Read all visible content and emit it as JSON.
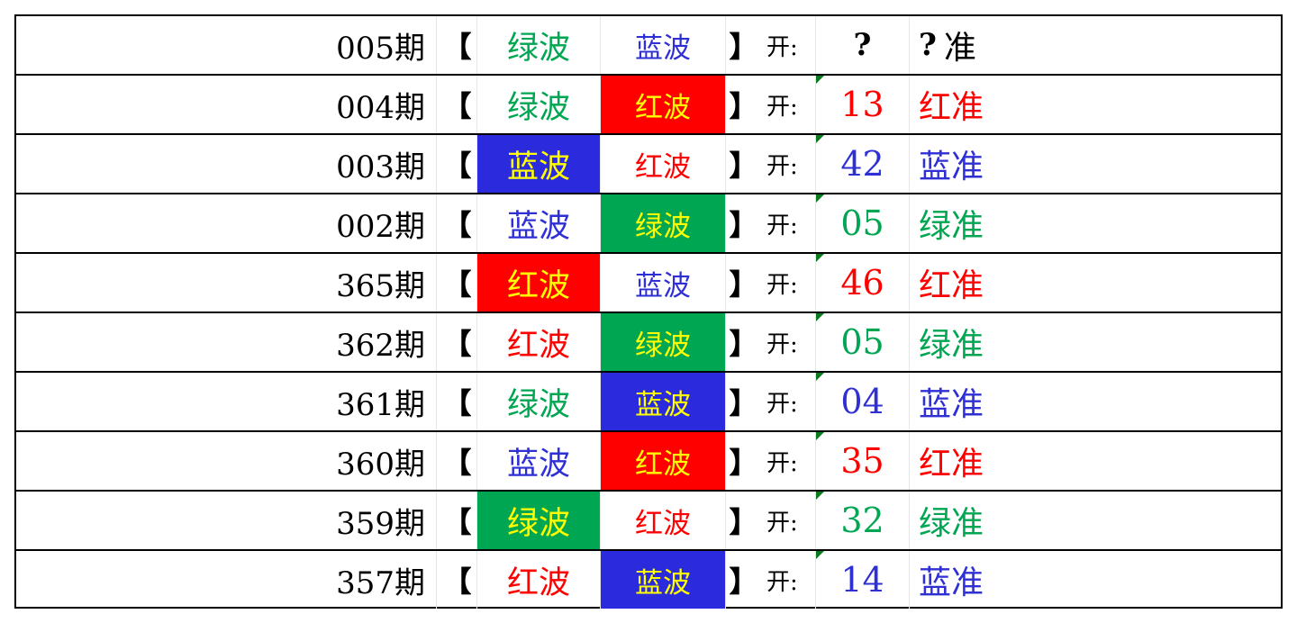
{
  "rows": [
    {
      "period": "005期",
      "left_bracket": "【",
      "c1": {
        "text": "绿波",
        "fg": "#00a651",
        "bg": ""
      },
      "c2": {
        "text": "蓝波",
        "fg": "#2f2fd6",
        "bg": ""
      },
      "right_bracket": "】",
      "kai": "开:",
      "number": {
        "text": "?",
        "color": "#000000"
      },
      "result": {
        "prefix": "? ",
        "text": "准",
        "color": "#000000"
      },
      "marker": false
    },
    {
      "period": "004期",
      "left_bracket": "【",
      "c1": {
        "text": "绿波",
        "fg": "#00a651",
        "bg": ""
      },
      "c2": {
        "text": "红波",
        "fg": "#ffff00",
        "bg": "#ff0000"
      },
      "right_bracket": "】",
      "kai": "开:",
      "number": {
        "text": "13",
        "color": "#ff0000"
      },
      "result": {
        "prefix": "",
        "text": "红准",
        "color": "#ff0000"
      },
      "marker": true
    },
    {
      "period": "003期",
      "left_bracket": "【",
      "c1": {
        "text": "蓝波",
        "fg": "#ffff00",
        "bg": "#2b2bdd"
      },
      "c2": {
        "text": "红波",
        "fg": "#ff0000",
        "bg": ""
      },
      "right_bracket": "】",
      "kai": "开:",
      "number": {
        "text": "42",
        "color": "#2f2fd6"
      },
      "result": {
        "prefix": "",
        "text": "蓝准",
        "color": "#2f2fd6"
      },
      "marker": true
    },
    {
      "period": "002期",
      "left_bracket": "【",
      "c1": {
        "text": "蓝波",
        "fg": "#2f2fd6",
        "bg": ""
      },
      "c2": {
        "text": "绿波",
        "fg": "#ffff00",
        "bg": "#00a651"
      },
      "right_bracket": "】",
      "kai": "开:",
      "number": {
        "text": "05",
        "color": "#00a651"
      },
      "result": {
        "prefix": "",
        "text": "绿准",
        "color": "#00a651"
      },
      "marker": true
    },
    {
      "period": "365期",
      "left_bracket": "【",
      "c1": {
        "text": "红波",
        "fg": "#ffff00",
        "bg": "#ff0000"
      },
      "c2": {
        "text": "蓝波",
        "fg": "#2f2fd6",
        "bg": ""
      },
      "right_bracket": "】",
      "kai": "开:",
      "number": {
        "text": "46",
        "color": "#ff0000"
      },
      "result": {
        "prefix": "",
        "text": "红准",
        "color": "#ff0000"
      },
      "marker": true
    },
    {
      "period": "362期",
      "left_bracket": "【",
      "c1": {
        "text": "红波",
        "fg": "#ff0000",
        "bg": ""
      },
      "c2": {
        "text": "绿波",
        "fg": "#ffff00",
        "bg": "#00a651"
      },
      "right_bracket": "】",
      "kai": "开:",
      "number": {
        "text": "05",
        "color": "#00a651"
      },
      "result": {
        "prefix": "",
        "text": "绿准",
        "color": "#00a651"
      },
      "marker": true
    },
    {
      "period": "361期",
      "left_bracket": "【",
      "c1": {
        "text": "绿波",
        "fg": "#00a651",
        "bg": ""
      },
      "c2": {
        "text": "蓝波",
        "fg": "#ffff00",
        "bg": "#2b2bdd"
      },
      "right_bracket": "】",
      "kai": "开:",
      "number": {
        "text": "04",
        "color": "#2f2fd6"
      },
      "result": {
        "prefix": "",
        "text": "蓝准",
        "color": "#2f2fd6"
      },
      "marker": true
    },
    {
      "period": "360期",
      "left_bracket": "【",
      "c1": {
        "text": "蓝波",
        "fg": "#2f2fd6",
        "bg": ""
      },
      "c2": {
        "text": "红波",
        "fg": "#ffff00",
        "bg": "#ff0000"
      },
      "right_bracket": "】",
      "kai": "开:",
      "number": {
        "text": "35",
        "color": "#ff0000"
      },
      "result": {
        "prefix": "",
        "text": "红准",
        "color": "#ff0000"
      },
      "marker": true
    },
    {
      "period": "359期",
      "left_bracket": "【",
      "c1": {
        "text": "绿波",
        "fg": "#ffff00",
        "bg": "#00a651"
      },
      "c2": {
        "text": "红波",
        "fg": "#ff0000",
        "bg": ""
      },
      "right_bracket": "】",
      "kai": "开:",
      "number": {
        "text": "32",
        "color": "#00a651"
      },
      "result": {
        "prefix": "",
        "text": "绿准",
        "color": "#00a651"
      },
      "marker": true
    },
    {
      "period": "357期",
      "left_bracket": "【",
      "c1": {
        "text": "红波",
        "fg": "#ff0000",
        "bg": ""
      },
      "c2": {
        "text": "蓝波",
        "fg": "#ffff00",
        "bg": "#2b2bdd"
      },
      "right_bracket": "】",
      "kai": "开:",
      "number": {
        "text": "14",
        "color": "#2f2fd6"
      },
      "result": {
        "prefix": "",
        "text": "蓝准",
        "color": "#2f2fd6"
      },
      "marker": true
    }
  ]
}
